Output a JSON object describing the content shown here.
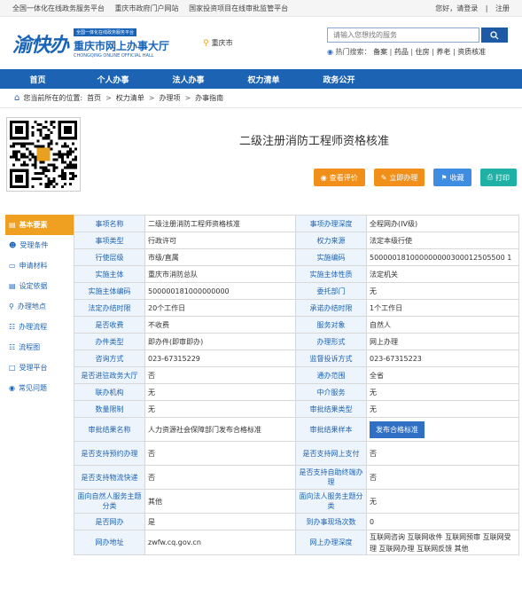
{
  "topbar": {
    "links": [
      "全国一体化在线政务服务平台",
      "重庆市政府门户网站",
      "国家投资项目在线审批监管平台"
    ],
    "greeting": "您好，请登录",
    "register": "注册"
  },
  "header": {
    "logo_mark": "渝快办",
    "slogan": "全国一体化在线政务服务平台",
    "title": "重庆市网上办事大厅",
    "subtitle_en": "CHONGQING ONLINE OFFICIAL HALL",
    "location": "重庆市",
    "search_placeholder": "请输入您想找的服务",
    "hot_label": "热门搜索：",
    "hot_items": [
      "备案",
      "药品",
      "住房",
      "养老",
      "资质核准"
    ]
  },
  "nav": [
    "首页",
    "个人办事",
    "法人办事",
    "权力清单",
    "政务公开"
  ],
  "breadcrumb": {
    "prefix": "您当前所在的位置:",
    "items": [
      "首页",
      "权力清单",
      "办理项",
      "办事指南"
    ]
  },
  "page_title": "二级注册消防工程师资格核准",
  "actions": {
    "eval": "查看评价",
    "apply": "立即办理",
    "fav": "收藏",
    "print": "打印"
  },
  "sidebar": [
    {
      "label": "基本要素",
      "icon": "document-icon"
    },
    {
      "label": "受理条件",
      "icon": "users-icon"
    },
    {
      "label": "申请材料",
      "icon": "folder-icon"
    },
    {
      "label": "设定依据",
      "icon": "list-icon"
    },
    {
      "label": "办理地点",
      "icon": "pin-icon"
    },
    {
      "label": "办理流程",
      "icon": "flow-icon"
    },
    {
      "label": "流程图",
      "icon": "chart-icon"
    },
    {
      "label": "受理平台",
      "icon": "monitor-icon"
    },
    {
      "label": "常见问题",
      "icon": "question-icon"
    }
  ],
  "table": {
    "rows": [
      [
        "事项名称",
        "二级注册消防工程师资格核准",
        "事项办理深度",
        "全程网办(IV级)"
      ],
      [
        "事项类型",
        "行政许可",
        "权力来源",
        "法定本级行使"
      ],
      [
        "行使层级",
        "市级/直属",
        "实施编码",
        "500000181000000000300012505500 1"
      ],
      [
        "实施主体",
        "重庆市消防总队",
        "实施主体性质",
        "法定机关"
      ],
      [
        "实施主体编码",
        "500000181000000000",
        "委托部门",
        "无"
      ],
      [
        "法定办结时限",
        "20个工作日",
        "承诺办结时限",
        "1个工作日"
      ],
      [
        "是否收费",
        "不收费",
        "服务对象",
        "自然人"
      ],
      [
        "办件类型",
        "即办件(即审即办)",
        "办理形式",
        "网上办理"
      ],
      [
        "咨询方式",
        "023-67315229",
        "监督投诉方式",
        "023-67315223"
      ],
      [
        "是否进驻政务大厅",
        "否",
        "通办范围",
        "全省"
      ],
      [
        "联办机构",
        "无",
        "中介服务",
        "无"
      ],
      [
        "数量限制",
        "无",
        "审批结果类型",
        "无"
      ],
      [
        "审批结果名称",
        "人力资源社会保障部门发布合格标准",
        "审批结果样本",
        "发布合格标准"
      ],
      [
        "是否支持预约办理",
        "否",
        "是否支持网上支付",
        "否"
      ],
      [
        "是否支持物流快递",
        "否",
        "是否支持自助终端办理",
        "否"
      ],
      [
        "面向自然人服务主题分类",
        "其他",
        "面向法人服务主题分类",
        "无"
      ],
      [
        "是否网办",
        "是",
        "到办事现场次数",
        "0"
      ],
      [
        "网办地址",
        "zwfw.cq.gov.cn",
        "网上办理深度",
        "互联网咨询 互联网收件 互联网预审 互联网受理 互联网办理 互联网反馈 其他"
      ]
    ]
  }
}
